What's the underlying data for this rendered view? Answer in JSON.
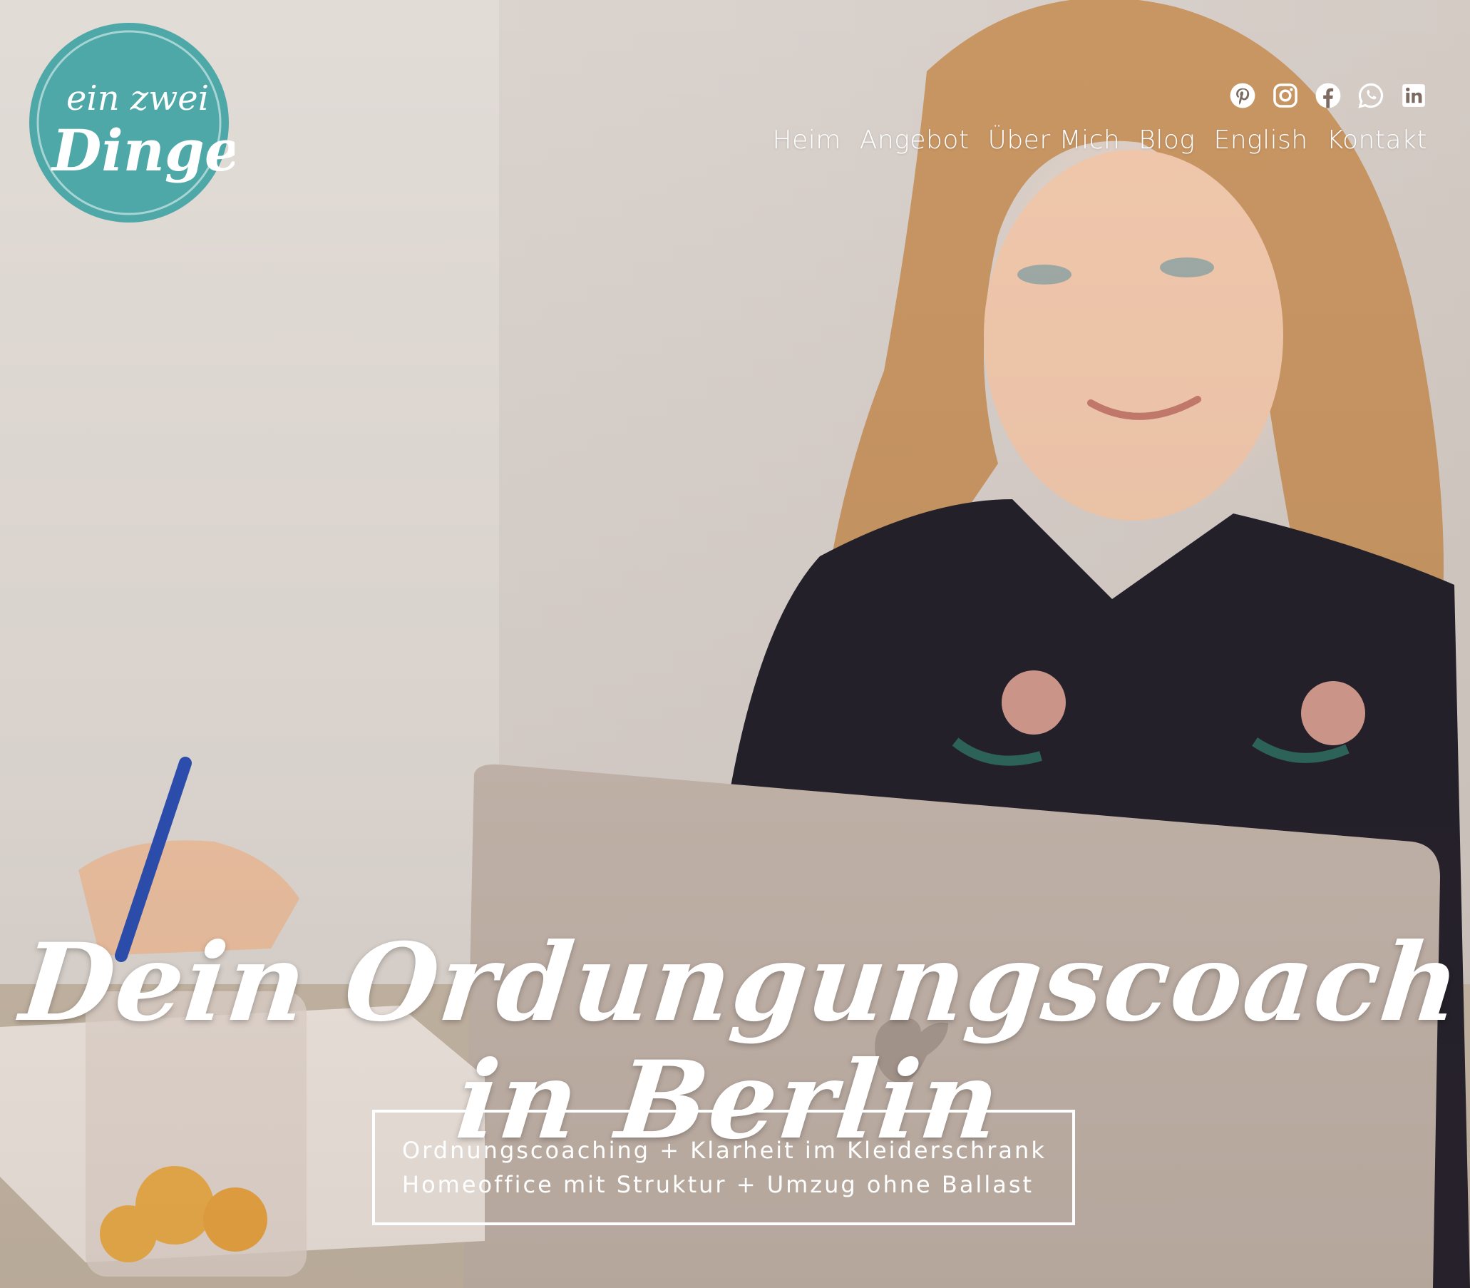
{
  "brand": {
    "logo_text_top": "ein zwei",
    "logo_text_main": "Dinge",
    "accent_color": "#4fa8a8"
  },
  "social": [
    {
      "name": "pinterest",
      "icon": "pinterest-icon"
    },
    {
      "name": "instagram",
      "icon": "instagram-icon"
    },
    {
      "name": "facebook",
      "icon": "facebook-icon"
    },
    {
      "name": "whatsapp",
      "icon": "whatsapp-icon"
    },
    {
      "name": "linkedin",
      "icon": "linkedin-icon"
    }
  ],
  "nav": {
    "items": [
      {
        "label": "Heim"
      },
      {
        "label": "Angebot"
      },
      {
        "label": "Über Mich"
      },
      {
        "label": "Blog"
      },
      {
        "label": "English"
      },
      {
        "label": "Kontakt"
      }
    ]
  },
  "hero": {
    "headline": "Dein Ordungungscoach in Berlin",
    "tagline_1": "Ordnungscoaching + Klarheit im Kleiderschrank",
    "tagline_2": "Homeoffice mit Struktur + Umzug ohne Ballast"
  }
}
